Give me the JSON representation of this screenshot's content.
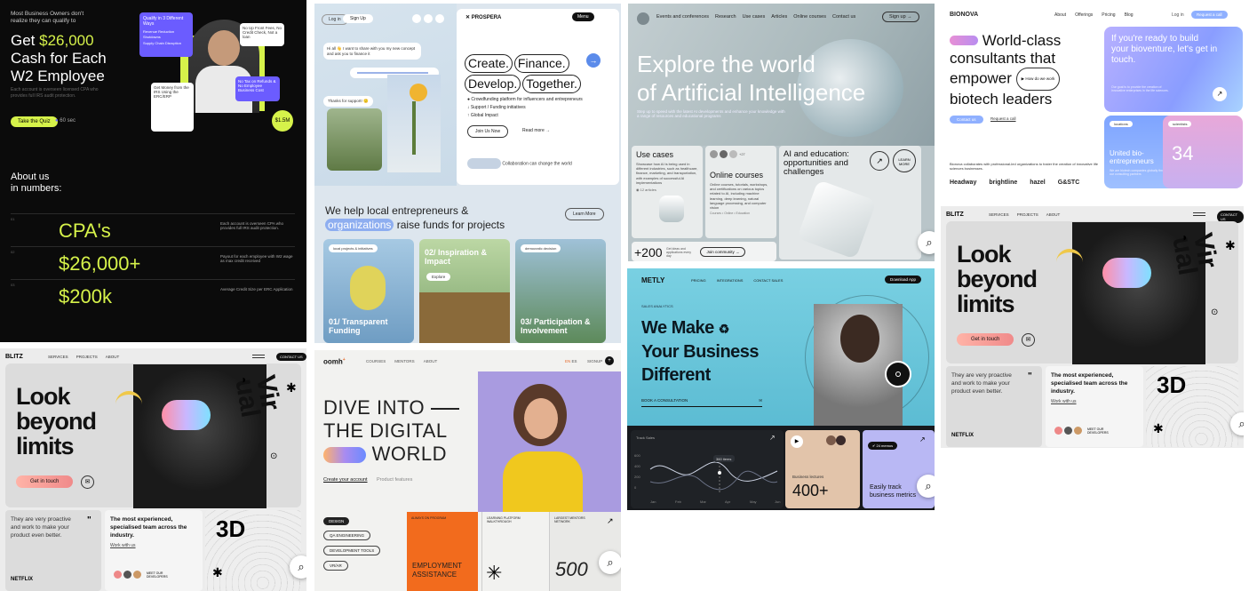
{
  "t1": {
    "eyebrow": "Most Business Owners don't realize they can qualify to",
    "h1a": "Get ",
    "h1amt": "$26,000",
    "h1b": "Cash for Each",
    "h1c": "W2 Employee",
    "sub": "Each account is overseen  licensed CPA who provides full IRS audit protection.",
    "cta": "Take the Quiz",
    "cta2": "60 sec",
    "qual_title": "Qualify in 3 Different Ways",
    "qual_items": [
      "Revenue Reduction",
      "Shutdowns",
      "Supply Chain Disruption"
    ],
    "card2": "No Up Front Fees, No Credit Check, Not a loan",
    "card3": "Get Money from the IRS Using the ERC/ERP",
    "card4": "No Tax on Refunds & No Employee Business Cost",
    "badge": "$1.5M",
    "about": "About us\nin numbers:",
    "rows": [
      {
        "num": "01",
        "val": "CPA's",
        "desc": "Each account is overseen CPA who provides full IRS audit protection."
      },
      {
        "num": "02",
        "val": "$26,000+",
        "desc": "Payout for each employee with W2 wage as max credit received"
      },
      {
        "num": "03",
        "val": "$200k",
        "desc": "Average Credit Size per ERC Application"
      }
    ],
    "accent": "#d6f24a"
  },
  "t2": {
    "nav_login": "Log in",
    "nav_signup": "Sign Up",
    "chat1": "Hi all 👋 I want to share with you my new concept and ask you to finance it",
    "chat2": "Thanks for support! 🙂",
    "brand": "PROSPERA",
    "menu": "Menu",
    "headline": [
      "Create.",
      "Finance.",
      "Develop.",
      "Together."
    ],
    "bullets": [
      "Crowdfunding platform for influencers and entrepreneurs",
      "Support / Funding initiatives",
      "Global Impact"
    ],
    "join": "Join Us Now",
    "more": "Read more",
    "collab": "Collaboration can change the world",
    "help1": "We help local entrepreneurs &",
    "help_hl": "organizations",
    "help2": "raise funds for projects",
    "learn": "Learn More",
    "cards": [
      {
        "tag": "local projects & initiatives",
        "title": "01/ Transparent Funding"
      },
      {
        "tag": "",
        "title": "02/ Inspiration & Impact",
        "btn": "Explore"
      },
      {
        "tag": "democratic decision",
        "title": "03/ Participation & Involvement"
      }
    ]
  },
  "t3": {
    "nav": [
      "Events and conferences",
      "Research",
      "Use cases",
      "Articles",
      "Online courses",
      "Contact us"
    ],
    "signup": "Sign up",
    "hero1": "Explore the world",
    "hero2": "of Artificial Intelligence",
    "herosub": "Step up to speed with the latest AI developments and enhance your knowledge with a range of resources and educational programs",
    "uc_title": "Use cases",
    "uc_text": "Showcase how AI is being used in different industries, such as healthcare, finance, marketing, and transportation, with examples of successful AI implementations",
    "uc_meta": "12 articles",
    "oc_title": "Online courses",
    "oc_text": "Online courses, tutorials, workshops, and certifications on various topics related to AI, including machine learning, deep learning, natural language processing, and computer vision",
    "oc_meta": "Courses • Online • Education",
    "ai_title": "AI and education: opportunities and challenges",
    "learn": "LEARN MORE",
    "stat": "+200",
    "stat_sub": "Get ideas and applications every day",
    "join": "Join community",
    "avatars_more": "+27"
  },
  "t4": {
    "brand": "BIONOVA",
    "nav": [
      "About",
      "Offerings",
      "Pricing",
      "Blog"
    ],
    "login": "Log in",
    "request": "Request a call",
    "h1": [
      "World-class",
      "consultants that",
      "empower",
      "biotech leaders"
    ],
    "how": "How do we work",
    "contact": "Contact us",
    "request2": "Request a call",
    "desc": "Bionova collaborates with professional-led organizations to foster the creation of innovative life sciences businesses.",
    "logos": [
      "Headway",
      "brightline",
      "hazel",
      "G&STC"
    ],
    "card1": "If you're ready to build your bioventure, let's get in touch.",
    "card1sub": "Our goal is to provide the creation of innovative enterprises in the life sciences.",
    "tag1": "locations",
    "tag2": "scientists",
    "card2": "United bio-entrepreneurs",
    "card2sub": "We are biotech companies globally through our consulting partners",
    "num": "34"
  },
  "blitz": {
    "brand": "BLITZ",
    "nav": [
      "SERVICES",
      "PROJECTS",
      "ABOUT"
    ],
    "contact": "CONTACT US",
    "h1": [
      "Look",
      "beyond",
      "limits"
    ],
    "cta": "Get in touch",
    "quote": "They are very proactive and work to make your product even better.",
    "team": "The most experienced, specialised team across the industry.",
    "work": "Work with us",
    "client": "NETFLIX",
    "meet": "MEET OUR DEVELOPERS",
    "big": "3D",
    "viral": "Vir\nual"
  },
  "t6": {
    "brand": "oomh",
    "nav": [
      "COURSES",
      "MENTORS",
      "ABOUT"
    ],
    "lang": [
      "EN",
      "ES"
    ],
    "signup": "SIGNUP",
    "h1": [
      "DIVE INTO",
      "THE DIGITAL",
      "WORLD"
    ],
    "create": "Create your account",
    "features": "Product features",
    "tags": [
      "DESIGN",
      "QA ENGINEERING",
      "DEVELOPMENT TOOLS",
      "VR/AR"
    ],
    "c1top": "ALWAYS ON PROGRAM",
    "c1": "EMPLOYMENT ASSISTANCE",
    "c2top": "LEARNING PLATFORM WALKTHROUGH",
    "c3top": "LARGEST MENTORS NETWORK",
    "c3": "500"
  },
  "t7": {
    "brand": "METLY",
    "nav": [
      "PRICING",
      "INTEGRATIONS",
      "CONTACT SALES"
    ],
    "download": "Download App",
    "tag": "SALES ANALYTICS",
    "h1": [
      "We Make",
      "Your Business",
      "Different"
    ],
    "book": "BOOK A CONSULTATION",
    "chart_title": "Track Sales",
    "months": [
      "Jan",
      "Feb",
      "Mar",
      "Apr",
      "May",
      "Jun"
    ],
    "yticks": [
      "600",
      "400",
      "200",
      "0"
    ],
    "tooltip": "360 items",
    "lectures": "Business lectures",
    "stat": "400+",
    "memos": "24 memos",
    "track": "Easily track business metrics"
  }
}
